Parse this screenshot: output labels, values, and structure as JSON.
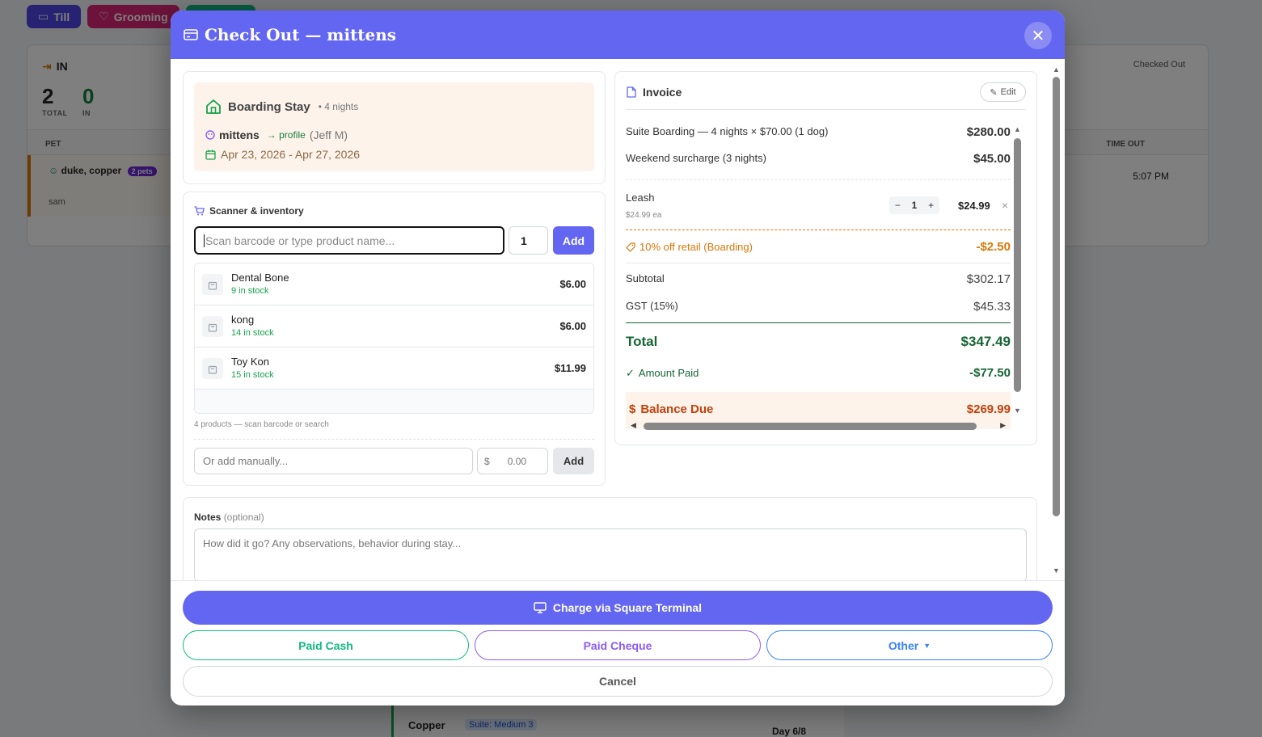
{
  "background": {
    "tabs": [
      {
        "label": "Till"
      },
      {
        "label": "Grooming"
      }
    ],
    "in_title": "IN",
    "stats": [
      {
        "value": "2",
        "label": "TOTAL"
      },
      {
        "value": "0",
        "label": "IN"
      }
    ],
    "checked_out": "Checked Out",
    "col_pet": "PET",
    "col_time_out": "TIME OUT",
    "row": {
      "name": "duke, copper",
      "badge": "2 pets",
      "owner": "sam",
      "time": "5:07 PM"
    },
    "bottom": {
      "name": "Copper",
      "suite": "Suite: Medium 3",
      "day": "Day 6/8"
    }
  },
  "modal": {
    "title": "Check Out — mittens",
    "close_label": "✕"
  },
  "stay": {
    "title": "Boarding Stay",
    "nights": "• 4 nights",
    "pet": "mittens",
    "profile_link": "→ profile",
    "owner": "(Jeff M)",
    "dates": "Apr 23, 2026 - Apr 27, 2026"
  },
  "scanner": {
    "title": "Scanner & inventory",
    "placeholder": "Scan barcode or type product name...",
    "qty": "1",
    "add_label": "Add",
    "products": [
      {
        "name": "Dental Bone",
        "stock": "9 in stock",
        "price": "$6.00"
      },
      {
        "name": "kong",
        "stock": "14 in stock",
        "price": "$6.00"
      },
      {
        "name": "Toy Kon",
        "stock": "15 in stock",
        "price": "$11.99"
      }
    ],
    "note": "4 products — scan barcode or search",
    "manual_placeholder": "Or add manually...",
    "currency": "$",
    "price_placeholder": "0.00",
    "manual_add_label": "Add"
  },
  "invoice": {
    "title": "Invoice",
    "edit_label": "Edit",
    "lines": [
      {
        "label": "Suite Boarding — 4 nights × $70.00 (1 dog)",
        "amount": "$280.00"
      },
      {
        "label": "Weekend surcharge (3 nights)",
        "amount": "$45.00"
      }
    ],
    "leash": {
      "label": "Leash",
      "each": "$24.99 ea",
      "qty": "1",
      "minus": "−",
      "plus": "+",
      "amount": "$24.99",
      "remove": "×"
    },
    "discount": {
      "label": "10% off retail (Boarding)",
      "amount": "-$2.50"
    },
    "subtotal": {
      "label": "Subtotal",
      "amount": "$302.17"
    },
    "gst": {
      "label": "GST (15%)",
      "amount": "$45.33"
    },
    "total": {
      "label": "Total",
      "amount": "$347.49"
    },
    "paid": {
      "label": "Amount Paid",
      "amount": "-$77.50"
    },
    "balance": {
      "label": "Balance Due",
      "amount": "$269.99"
    }
  },
  "notes": {
    "label": "Notes",
    "optional": "(optional)",
    "placeholder": "How did it go? Any observations, behavior during stay..."
  },
  "footer": {
    "charge_label": "Charge via Square Terminal",
    "paid_cash": "Paid Cash",
    "paid_cheque": "Paid Cheque",
    "other": "Other",
    "cancel": "Cancel"
  },
  "colors": {
    "primary": "#6366f1",
    "success": "#166534",
    "warning": "#c2410c",
    "cash": "#10b981",
    "cheque": "#8b5cf6",
    "other": "#3b82f6"
  }
}
